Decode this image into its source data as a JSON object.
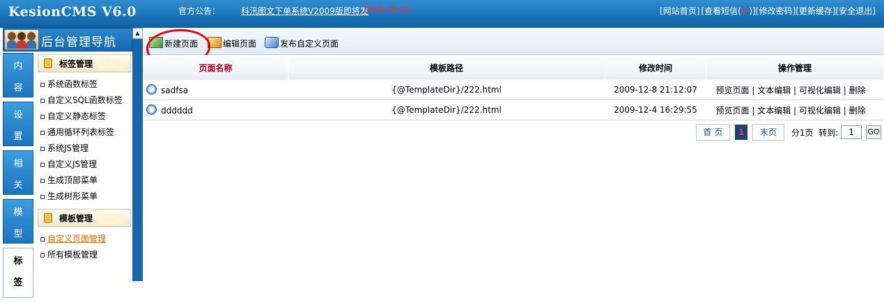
{
  "header": {
    "logo": "KesionCMS V6.0",
    "notice_label": "官方公告：",
    "notice_link": "科汛图文下单系统V2009版即将发",
    "notice_date": "2009-08-05",
    "links": {
      "home": "[网站首页]",
      "messages_prefix": "[查看短信(",
      "messages_count": "0",
      "messages_suffix": ")]",
      "password": "[修改密码]",
      "cache": "[更新缓存]",
      "logout": "[安全退出]"
    }
  },
  "sidebar": {
    "title": "后台管理导航",
    "tabs": [
      {
        "c1": "内",
        "c2": "容"
      },
      {
        "c1": "设",
        "c2": "置"
      },
      {
        "c1": "相",
        "c2": "关"
      },
      {
        "c1": "模",
        "c2": "型"
      },
      {
        "c1": "标",
        "c2": "签"
      }
    ],
    "groups": [
      {
        "title": "标签管理",
        "items": [
          "系统函数标签",
          "自定义SQL函数标签",
          "自定义静态标签",
          "通用循环列表标签",
          "系统JS管理",
          "自定义JS管理",
          "生成顶部菜单",
          "生成树形菜单"
        ]
      },
      {
        "title": "模板管理",
        "items": [
          "自定义页面管理",
          "所有模板管理"
        ]
      }
    ]
  },
  "toolbar": {
    "new_page": "新建页面",
    "edit_page": "编辑页面",
    "publish_page": "发布自定义页面"
  },
  "table": {
    "headers": [
      "页面名称",
      "模板路径",
      "修改时间",
      "操作管理"
    ],
    "rows": [
      {
        "name": "sadfsa",
        "path": "{@TemplateDir}/222.html",
        "time": "2009-12-8 21:12:07"
      },
      {
        "name": "dddddd",
        "path": "{@TemplateDir}/222.html",
        "time": "2009-12-4 16:29:55"
      }
    ],
    "actions": {
      "preview": "预览页面",
      "sep": " | ",
      "text_edit": "文本编辑",
      "visual_edit": "可视化编辑",
      "delete": "删除"
    }
  },
  "pager": {
    "first": "首 页",
    "current": "1",
    "last": "末页",
    "total": "分1页",
    "goto_label": "转到:",
    "goto_value": "1",
    "go": "GO"
  }
}
